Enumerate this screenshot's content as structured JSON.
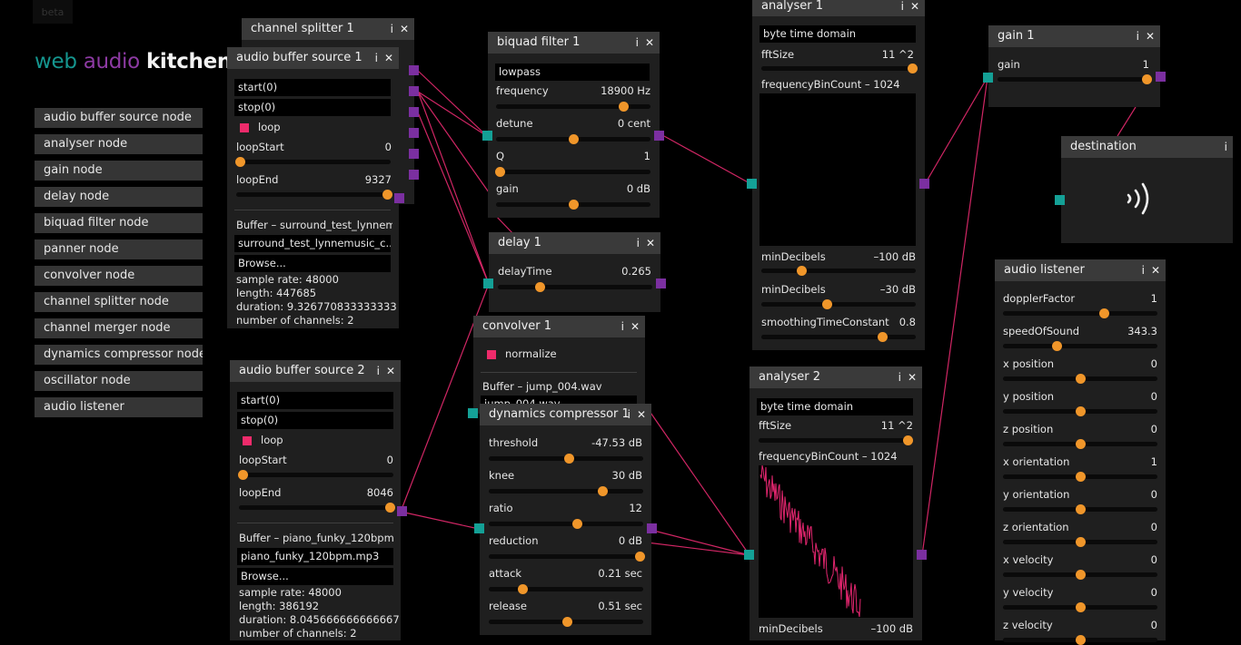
{
  "beta": "beta",
  "logo": {
    "web": "web",
    "audio": "audio",
    "kitchen": "kitchen"
  },
  "colors": {
    "background": "#000000",
    "node": "#1f1f1f",
    "header": "#3a3a3a",
    "knob": "#f0962a",
    "input_port": "#14a096",
    "output_port": "#7b2fa0",
    "wire": "#d02664",
    "checkbox": "#ee2b6b",
    "logo_web": "#15968f",
    "logo_audio": "#8d3aa3"
  },
  "menu": [
    "audio buffer source node",
    "analyser node",
    "gain node",
    "delay node",
    "biquad filter node",
    "panner node",
    "convolver node",
    "channel splitter node",
    "channel merger node",
    "dynamics compressor node",
    "oscillator node",
    "audio listener"
  ],
  "icons": {
    "info": "i",
    "close": "✕"
  },
  "channel_splitter": {
    "title": "channel splitter 1"
  },
  "abs1": {
    "title": "audio buffer source 1",
    "start": "start(0)",
    "stop": "stop(0)",
    "loop": "loop",
    "loopStart_label": "loopStart",
    "loopStart_value": "0",
    "loopEnd_label": "loopEnd",
    "loopEnd_value": "9327",
    "buffer_label": "Buffer – surround_test_lynnem...",
    "file": "surround_test_lynnemusic_c...",
    "browse": "Browse...",
    "sample_rate": "sample rate: 48000",
    "length": "length: 447685",
    "duration": "duration: 9.326770833333333",
    "channels": "number of channels: 2"
  },
  "abs2": {
    "title": "audio buffer source 2",
    "start": "start(0)",
    "stop": "stop(0)",
    "loop": "loop",
    "loopStart_label": "loopStart",
    "loopStart_value": "0",
    "loopEnd_label": "loopEnd",
    "loopEnd_value": "8046",
    "buffer_label": "Buffer – piano_funky_120bpm....",
    "file": "piano_funky_120bpm.mp3",
    "browse": "Browse...",
    "sample_rate": "sample rate: 48000",
    "length": "length: 386192",
    "duration": "duration: 8.045666666666667",
    "channels": "number of channels: 2"
  },
  "biquad": {
    "title": "biquad filter 1",
    "type": "lowpass",
    "frequency_label": "frequency",
    "frequency_value": "18900 Hz",
    "detune_label": "detune",
    "detune_value": "0 cent",
    "q_label": "Q",
    "q_value": "1",
    "gain_label": "gain",
    "gain_value": "0 dB"
  },
  "delay": {
    "title": "delay 1",
    "delayTime_label": "delayTime",
    "delayTime_value": "0.265"
  },
  "convolver": {
    "title": "convolver 1",
    "normalize": "normalize",
    "buffer_label": "Buffer – jump_004.wav",
    "file": "jump_004.wav"
  },
  "compressor": {
    "title": "dynamics compressor 1",
    "threshold_label": "threshold",
    "threshold_value": "-47.53 dB",
    "knee_label": "knee",
    "knee_value": "30 dB",
    "ratio_label": "ratio",
    "ratio_value": "12",
    "reduction_label": "reduction",
    "reduction_value": "0 dB",
    "attack_label": "attack",
    "attack_value": "0.21 sec",
    "release_label": "release",
    "release_value": "0.51 sec"
  },
  "analyser1": {
    "title": "analyser 1",
    "mode": "byte time domain",
    "fftSize_label": "fftSize",
    "fftSize_value": "11 ^2",
    "binCount": "frequencyBinCount – 1024",
    "minDb_label": "minDecibels",
    "minDb_value": "–100 dB",
    "maxDb_label": "minDecibels",
    "maxDb_value": "–30 dB",
    "smoothing_label": "smoothingTimeConstant",
    "smoothing_value": "0.8"
  },
  "analyser2": {
    "title": "analyser 2",
    "mode": "byte time domain",
    "fftSize_label": "fftSize",
    "fftSize_value": "11 ^2",
    "binCount": "frequencyBinCount – 1024",
    "minDb_label": "minDecibels",
    "minDb_value": "–100 dB"
  },
  "gain": {
    "title": "gain 1",
    "gain_label": "gain",
    "gain_value": "1"
  },
  "destination": {
    "title": "destination"
  },
  "listener": {
    "title": "audio listener",
    "rows": [
      {
        "label": "dopplerFactor",
        "value": "1"
      },
      {
        "label": "speedOfSound",
        "value": "343.3"
      },
      {
        "label": "x position",
        "value": "0"
      },
      {
        "label": "y position",
        "value": "0"
      },
      {
        "label": "z position",
        "value": "0"
      },
      {
        "label": "x orientation",
        "value": "1"
      },
      {
        "label": "y orientation",
        "value": "0"
      },
      {
        "label": "z orientation",
        "value": "0"
      },
      {
        "label": "x velocity",
        "value": "0"
      },
      {
        "label": "y velocity",
        "value": "0"
      },
      {
        "label": "z velocity",
        "value": "0"
      }
    ]
  }
}
